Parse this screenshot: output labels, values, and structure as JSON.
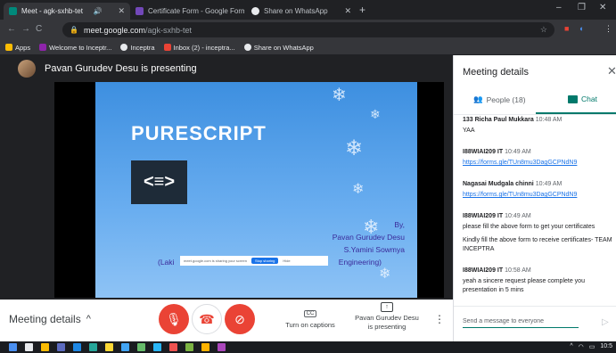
{
  "browser": {
    "tabs": [
      {
        "label": "Meet - agk-sxhb-tet",
        "active": true,
        "favicon_color": "#00897b"
      },
      {
        "label": "Certificate Form - Google Forms",
        "active": false,
        "favicon_color": "#7248b9"
      },
      {
        "label": "Share on WhatsApp",
        "active": false,
        "favicon_color": "#e8eaed"
      }
    ],
    "new_tab": "+",
    "window_controls": [
      "–",
      "❐",
      "✕"
    ],
    "url_host": "meet.google.com",
    "url_path": "/agk-sxhb-tet"
  },
  "bookmarks": [
    {
      "label": "Apps",
      "icon": "apps-grid-icon",
      "color": "#fbbc04"
    },
    {
      "label": "Welcome to Inceptr...",
      "icon": "inceptra-icon",
      "color": "#8e24aa"
    },
    {
      "label": "Inceptra",
      "icon": "globe-icon",
      "color": "#e8eaed"
    },
    {
      "label": "Inbox (2) - inceptra...",
      "icon": "gmail-icon",
      "color": "#ea4335"
    },
    {
      "label": "Share on WhatsApp",
      "icon": "globe-icon",
      "color": "#e8eaed"
    }
  ],
  "stage": {
    "presenter_text": "Pavan Gurudev Desu is presenting",
    "slide": {
      "title": "PURESCRIPT",
      "code_symbol": "<≡>",
      "credit_lines": [
        "By,",
        "Pavan Gurudev Desu",
        "S.Yamini Sowmya",
        "(Laki",
        "Engineering)"
      ]
    },
    "share_notice": {
      "text": "meet.google.com is sharing your screen",
      "stop_label": "Stop sharing",
      "hide_label": "Hide"
    }
  },
  "controls": {
    "meeting_details_label": "Meeting details",
    "captions_label": "Turn on captions",
    "captions_icon_text": "CC",
    "present_label_1": "Pavan Gurudev Desu",
    "present_label_2": "is presenting",
    "more_icon": "⋮"
  },
  "panel": {
    "title": "Meeting details",
    "people_label": "People (18)",
    "chat_label": "Chat",
    "messages": [
      {
        "sender": "133 Richa Paul Mukkara",
        "time": "10:48 AM",
        "lines": [
          "YAA"
        ],
        "link": ""
      },
      {
        "sender": "I88WIAI209 IT",
        "time": "10:49 AM",
        "lines": [],
        "link": "https://forms.gle/TUn8mu3DagGCPNdN9"
      },
      {
        "sender": "Nagasai Mudgala chinni",
        "time": "10:49 AM",
        "lines": [],
        "link": "https://forms.gle/TUn8mu3DagGCPNdN9"
      },
      {
        "sender": "I88WIAI209 IT",
        "time": "10:49 AM",
        "lines": [
          "please fill the above form to get your certificates",
          "Kindly fill the above form to receive certificates- TEAM INCEPTRA"
        ],
        "link": ""
      },
      {
        "sender": "I88WIAI209 IT",
        "time": "10:58 AM",
        "lines": [
          "yeah a sincere request please complete you presentation in 5 mins"
        ],
        "link": ""
      }
    ],
    "input_placeholder": "Send a message to everyone",
    "send_icon": "▷"
  },
  "taskbar": {
    "tray_clock": "10:5"
  },
  "colors": {
    "accent_teal": "#00796b",
    "hangup_red": "#ea4335",
    "link_blue": "#1a73e8",
    "slide_blue": "#3d8fe0"
  }
}
